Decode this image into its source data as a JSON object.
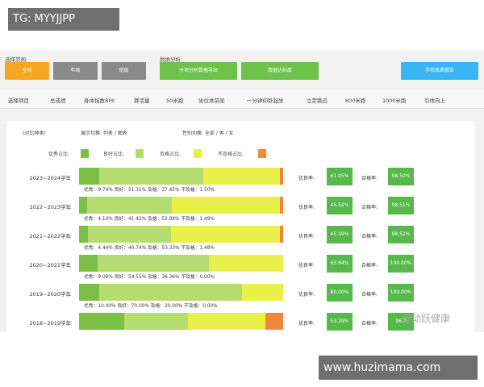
{
  "top_tag": "TG: MYYJJPP",
  "bottom_tag": "www.huzimama.com",
  "toolbar": {
    "range_label": "选择范围:",
    "range_buttons": [
      "全校",
      "年级",
      "班级"
    ],
    "analysis_label": "数据分析:",
    "analysis_buttons": [
      "分项分析数据导出",
      "数据达标度"
    ],
    "report_button": "学校体质报告"
  },
  "nav": {
    "items": [
      "选择项目",
      "总成绩",
      "身体指数BMI",
      "肺活量",
      "50米跑",
      "坐位体前屈",
      "一分钟仰卧起坐",
      "立定跳远",
      "800米跑",
      "1000米跑",
      "引体向上"
    ]
  },
  "filters": {
    "compare": "(对比种类)",
    "display": "展示切换: 列表 / 图表",
    "gender": "性别切换: 全部 / 男 / 女"
  },
  "legend": [
    {
      "label": "优秀占比:",
      "color": "#7bbf44"
    },
    {
      "label": "良好占比:",
      "color": "#b5dc6e"
    },
    {
      "label": "及格占比:",
      "color": "#eaf04a"
    },
    {
      "label": "不及格占比:",
      "color": "#f0883a"
    }
  ],
  "rows": [
    {
      "year": "2023~2024学年",
      "excellent": 9.74,
      "good": 51.31,
      "pass": 37.45,
      "fail": 1.5,
      "caption": "优秀：9.74%  良好：51.31%  及格：37.45%  不及格：1.50%",
      "excellent_rate": "61.05%",
      "pass_rate": "98.50%"
    },
    {
      "year": "2022~2023学年",
      "excellent": 4.1,
      "good": 41.42,
      "pass": 52.99,
      "fail": 1.49,
      "caption": "优秀：4.10%  良好：41.42%  及格：52.99%  不及格：1.49%",
      "excellent_rate": "45.52%",
      "pass_rate": "98.51%"
    },
    {
      "year": "2021~2022学年",
      "excellent": 4.44,
      "good": 40.74,
      "pass": 53.33,
      "fail": 1.48,
      "caption": "优秀：4.44%  良好：40.74%  及格：53.33%  不及格：1.48%",
      "excellent_rate": "45.19%",
      "pass_rate": "98.52%"
    },
    {
      "year": "2020~2021学年",
      "excellent": 9.09,
      "good": 54.55,
      "pass": 36.36,
      "fail": 0,
      "caption": "优秀：9.09%  良好：54.55%  及格：36.36%  不及格：0.00%",
      "excellent_rate": "63.64%",
      "pass_rate": "100.00%"
    },
    {
      "year": "2019~2020学年",
      "excellent": 10.0,
      "good": 70.0,
      "pass": 20.0,
      "fail": 0,
      "caption": "优秀：10.00%  良好：70.00%  及格：20.00%  不及格：0.00%",
      "excellent_rate": "80.00%",
      "pass_rate": "100.00%"
    },
    {
      "year": "2018~2019学年",
      "excellent": 22.0,
      "good": 31.29,
      "pass": 38.0,
      "fail": 8.71,
      "caption": "",
      "excellent_rate": "53.29%",
      "pass_rate": "96.7"
    }
  ],
  "labels": {
    "excellent_good": "优良率:",
    "pass": "合格率:"
  },
  "watermark": "@动跃健康",
  "colors": {
    "orange": "#f5a623",
    "gray": "#8a8a8a",
    "green": "#6cc24a",
    "blue": "#3ab4f2"
  }
}
